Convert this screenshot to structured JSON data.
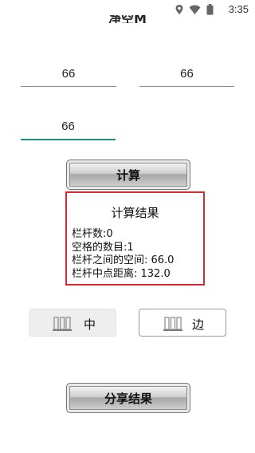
{
  "status_bar": {
    "time": "3:35",
    "icons": [
      "location-icon",
      "wifi-icon",
      "battery-icon"
    ]
  },
  "header": {
    "title_partial": "净空M"
  },
  "inputs": {
    "field1_value": "66",
    "field2_value": "66",
    "field3_value": "66"
  },
  "buttons": {
    "calculate_label": "计算",
    "share_label": "分享结果"
  },
  "result": {
    "title": "计算结果",
    "lines": [
      "栏杆数:0",
      "空格的数目:1",
      "栏杆之间的空间: 66.0",
      "栏杆中点距离: 132.0"
    ]
  },
  "modes": {
    "center_label": "中",
    "edge_label": "边",
    "selected": "中"
  },
  "colors": {
    "result_border": "#d9282f",
    "focused_underline": "#1e8f7a"
  }
}
